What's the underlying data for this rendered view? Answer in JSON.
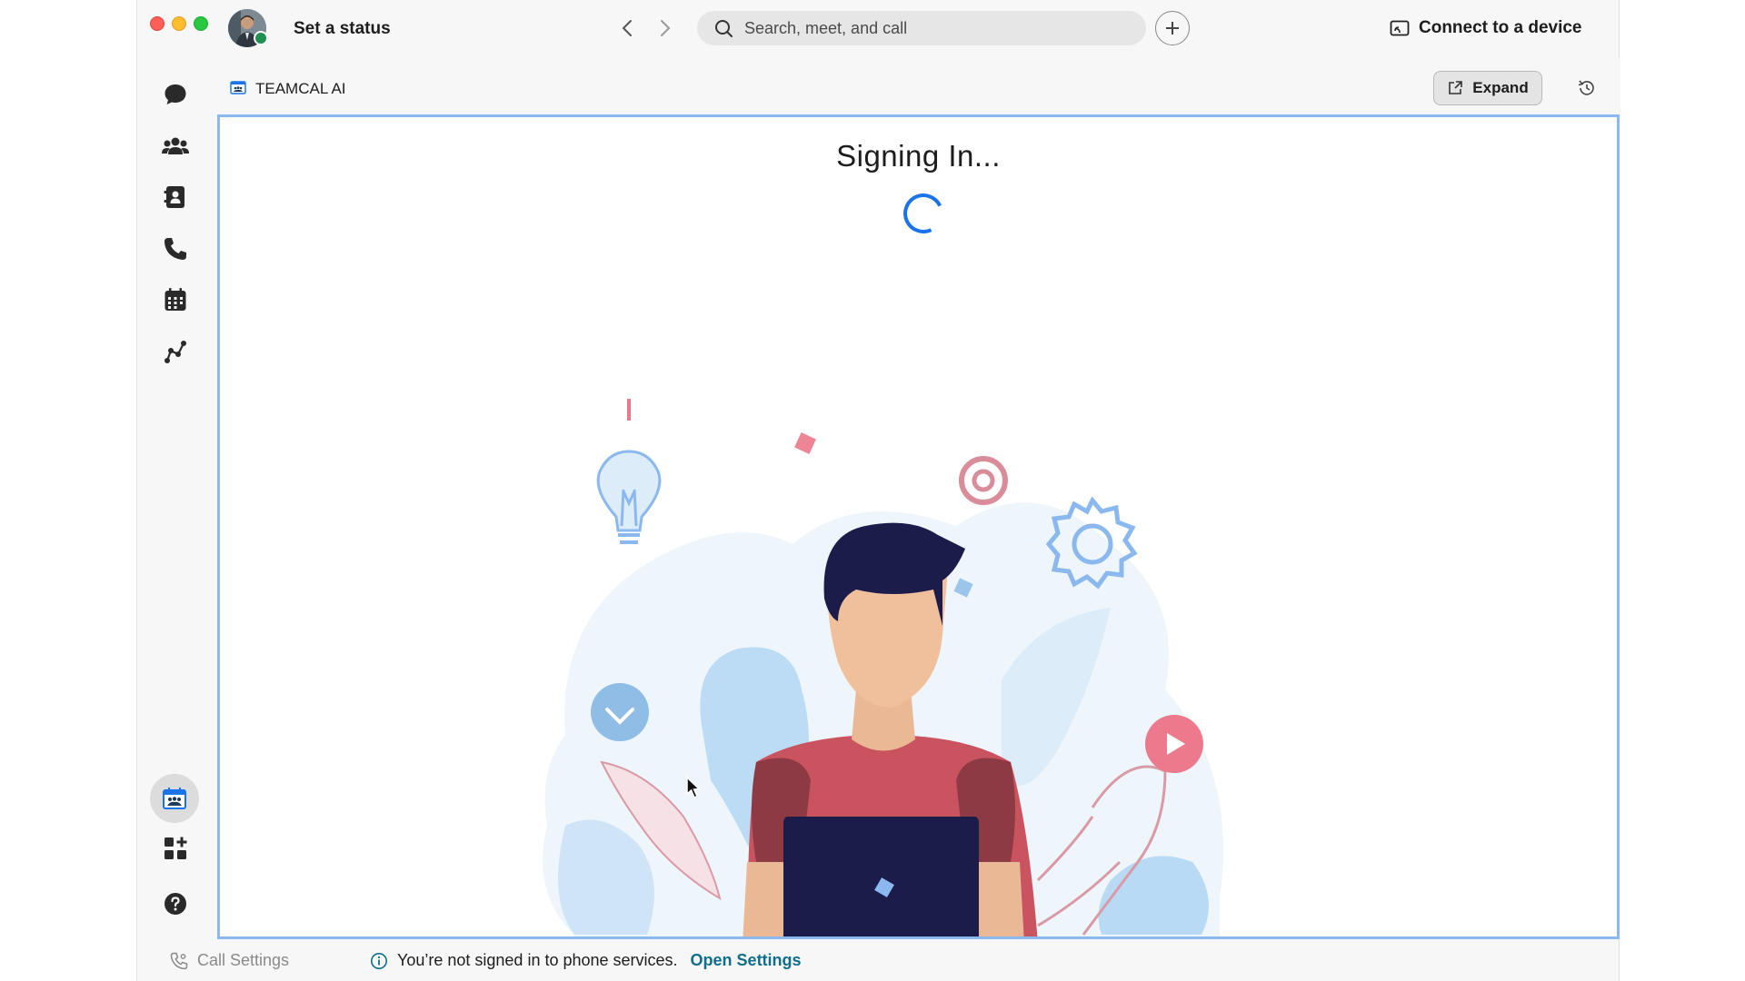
{
  "titlebar": {
    "status_label": "Set a status",
    "search_placeholder": "Search, meet, and call",
    "connect_label": "Connect to a device"
  },
  "sidebar": {
    "items": [
      {
        "name": "messaging",
        "icon": "chat-bubble-icon"
      },
      {
        "name": "teams",
        "icon": "people-group-icon"
      },
      {
        "name": "contacts",
        "icon": "contact-book-icon"
      },
      {
        "name": "calling",
        "icon": "phone-icon"
      },
      {
        "name": "calendar",
        "icon": "calendar-icon"
      },
      {
        "name": "analytics",
        "icon": "graph-nodes-icon"
      }
    ],
    "bottom_items": [
      {
        "name": "teamcal-app",
        "icon": "teamcal-app-icon",
        "active": true
      },
      {
        "name": "apps",
        "icon": "apps-grid-icon"
      },
      {
        "name": "help",
        "icon": "help-icon"
      }
    ]
  },
  "app": {
    "title": "TEAMCAL AI",
    "expand_label": "Expand"
  },
  "content": {
    "heading": "Signing In..."
  },
  "statusbar": {
    "call_settings_label": "Call Settings",
    "notice_text": "You’re not signed in to phone services.",
    "open_settings_label": "Open Settings"
  },
  "colors": {
    "accent_blue": "#1a73e8",
    "frame_border": "#8ab8ef",
    "presence_green": "#1f8f52",
    "link_teal": "#0f6e8a"
  }
}
